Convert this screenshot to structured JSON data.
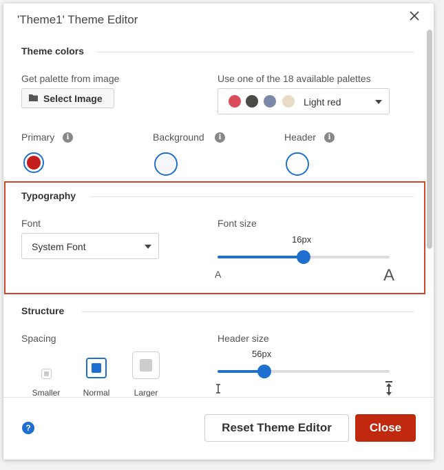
{
  "dialog": {
    "title": "'Theme1' Theme Editor",
    "close_icon": "close-icon"
  },
  "theme_colors": {
    "heading": "Theme colors",
    "palette_from_image_label": "Get palette from image",
    "select_image_button": "Select Image",
    "available_palettes_label": "Use one of the 18 available palettes",
    "palette_selected": "Light red",
    "palette_swatches": [
      "#d94c5c",
      "#4a4a46",
      "#7d89a8",
      "#e8dcc6"
    ],
    "primary_label": "Primary",
    "primary_color": "#c41e1e",
    "background_label": "Background",
    "background_color": "#f4f6f9",
    "header_label": "Header",
    "header_color": "#ffffff"
  },
  "typography": {
    "heading": "Typography",
    "font_label": "Font",
    "font_value": "System Font",
    "font_size_label": "Font size",
    "font_size_value": "16px",
    "font_size_fraction": 0.5,
    "small_a": "A",
    "large_a": "A"
  },
  "structure": {
    "heading": "Structure",
    "spacing_label": "Spacing",
    "spacing_options": [
      "Smaller",
      "Normal",
      "Larger"
    ],
    "spacing_selected": "Normal",
    "header_size_label": "Header size",
    "header_size_value": "56px",
    "header_size_fraction": 0.27
  },
  "footer": {
    "help_icon": "?",
    "reset_button": "Reset Theme Editor",
    "close_button": "Close"
  },
  "colors": {
    "accent": "#1e6fd0",
    "danger": "#c0290e",
    "highlight_border": "#d1432b"
  }
}
